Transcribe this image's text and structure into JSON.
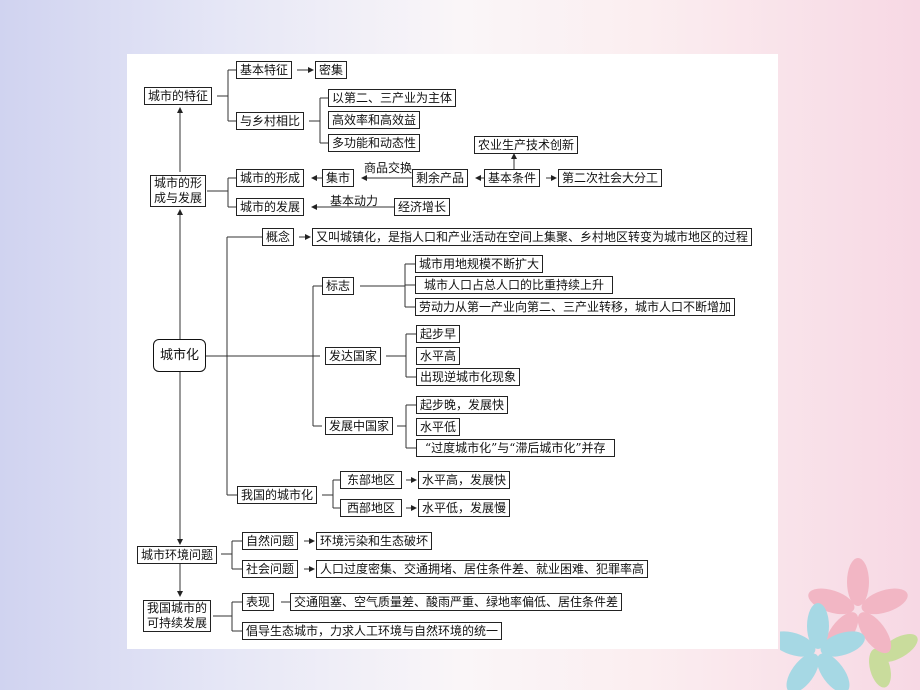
{
  "diagram": {
    "urban_features": {
      "title": "城市的特征",
      "basic_feature": "基本特征",
      "basic_value": "密集",
      "vs_rural": "与乡村相比",
      "vs_rural_items": [
        "以第二、三产业为主体",
        "高效率和高效益",
        "多功能和动态性"
      ]
    },
    "formation": {
      "title_line1": "城市的形",
      "title_line2": "成与发展",
      "formation": "城市的形成",
      "market": "集市",
      "exchange_label": "商品交换",
      "surplus": "剩余产品",
      "basic_condition": "基本条件",
      "agri_innovation": "农业生产技术创新",
      "division": "第二次社会大分工",
      "development": "城市的发展",
      "driving_label": "基本动力",
      "economy": "经济增长"
    },
    "urbanization": {
      "title": "城市化",
      "concept": "概念",
      "concept_text": "又叫城镇化，是指人口和产业活动在空间上集聚、乡村地区转变为城市地区的过程",
      "signs": "标志",
      "signs_items": [
        "城市用地规模不断扩大",
        "城市人口占总人口的比重持续上升",
        "劳动力从第一产业向第二、三产业转移，城市人口不断增加"
      ],
      "developed": "发达国家",
      "developed_items": [
        "起步早",
        "水平高",
        "出现逆城市化现象"
      ],
      "developing": "发展中国家",
      "developing_items": [
        "起步晚，发展快",
        "水平低",
        "“过度城市化”与“滞后城市化”并存"
      ],
      "china": "我国的城市化",
      "east": "东部地区",
      "east_value": "水平高，发展快",
      "west": "西部地区",
      "west_value": "水平低，发展慢"
    },
    "environment": {
      "title": "城市环境问题",
      "natural": "自然问题",
      "natural_value": "环境污染和生态破坏",
      "social": "社会问题",
      "social_value": "人口过度密集、交通拥堵、居住条件差、就业困难、犯罪率高"
    },
    "sustainable": {
      "title_line1": "我国城市的",
      "title_line2": "可持续发展",
      "manifestation": "表现",
      "manifestation_value": "交通阻塞、空气质量差、酸雨严重、绿地率偏低、居住条件差",
      "advocate": "倡导生态城市，力求人工环境与自然环境的统一"
    }
  }
}
